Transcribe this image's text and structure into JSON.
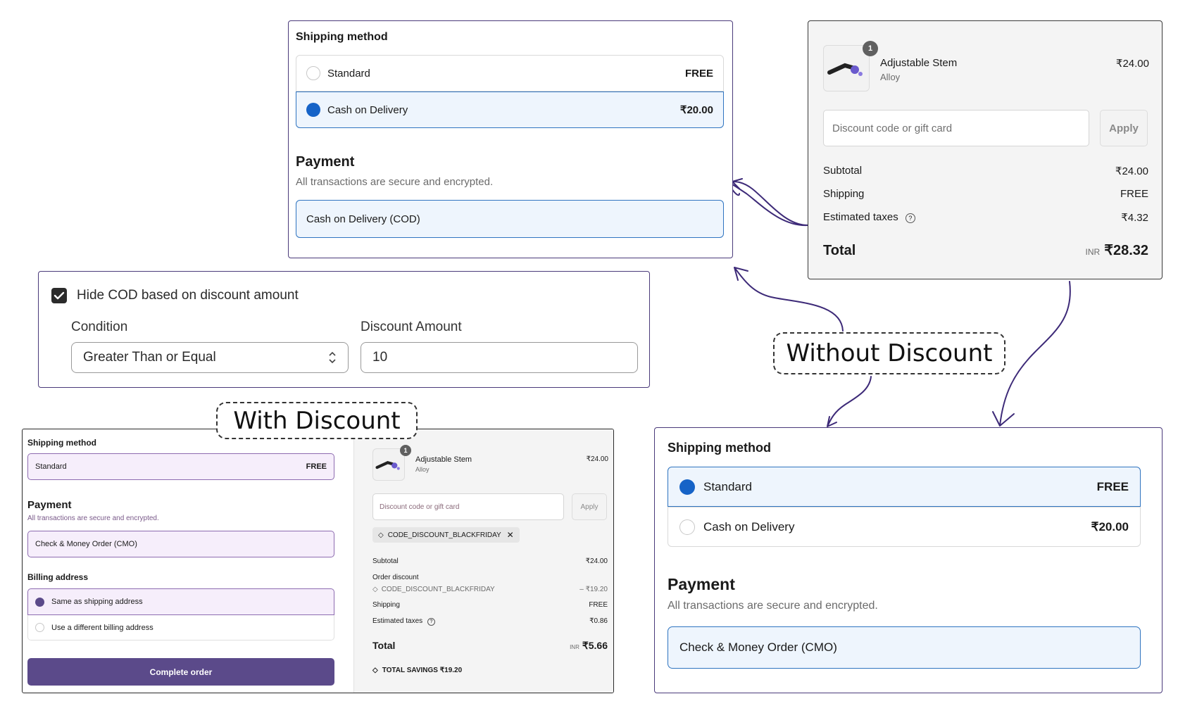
{
  "colors": {
    "accent": "#1663c7",
    "selected_bg": "#eef5fd",
    "frame": "#4a3a7a",
    "purple_btn": "#5b4a8a",
    "purple_field": "#f6eefb"
  },
  "labels": {
    "with_discount": "With Discount",
    "without_discount": "Without Discount"
  },
  "top_checkout": {
    "shipping_title": "Shipping method",
    "options": [
      {
        "label": "Standard",
        "price": "FREE",
        "selected": false
      },
      {
        "label": "Cash on Delivery",
        "price": "₹20.00",
        "selected": true
      }
    ],
    "payment_title": "Payment",
    "payment_subtitle": "All transactions are secure and encrypted.",
    "payment_method": "Cash on Delivery (COD)"
  },
  "top_summary": {
    "item": {
      "name": "Adjustable Stem",
      "variant": "Alloy",
      "price": "₹24.00",
      "qty": "1"
    },
    "discount_placeholder": "Discount code or gift card",
    "apply": "Apply",
    "rows": [
      {
        "label": "Subtotal",
        "value": "₹24.00"
      },
      {
        "label": "Shipping",
        "value": "FREE"
      },
      {
        "label": "Estimated taxes",
        "value": "₹4.32"
      }
    ],
    "total_label": "Total",
    "currency": "INR",
    "total_value": "₹28.32"
  },
  "settings": {
    "checkbox_label": "Hide COD based on discount amount",
    "checked": true,
    "condition_label": "Condition",
    "condition_value": "Greater Than or Equal",
    "amount_label": "Discount Amount",
    "amount_value": "10"
  },
  "with_discount": {
    "shipping_title": "Shipping method",
    "shipping_option": {
      "label": "Standard",
      "price": "FREE"
    },
    "payment_title": "Payment",
    "payment_subtitle": "All transactions are secure and encrypted.",
    "payment_method": "Check & Money Order (CMO)",
    "billing_title": "Billing address",
    "billing_options": [
      {
        "label": "Same as shipping address",
        "selected": true
      },
      {
        "label": "Use a different billing address",
        "selected": false
      }
    ],
    "complete_button": "Complete order",
    "summary": {
      "item": {
        "name": "Adjustable Stem",
        "variant": "Alloy",
        "price": "₹24.00",
        "qty": "1"
      },
      "discount_placeholder": "Discount code or gift card",
      "apply": "Apply",
      "code_tag": "CODE_DISCOUNT_BLACKFRIDAY",
      "subtotal_label": "Subtotal",
      "subtotal_value": "₹24.00",
      "order_discount_label": "Order discount",
      "order_discount_code": "CODE_DISCOUNT_BLACKFRIDAY",
      "order_discount_value": "– ₹19.20",
      "shipping_label": "Shipping",
      "shipping_value": "FREE",
      "taxes_label": "Estimated taxes",
      "taxes_value": "₹0.86",
      "total_label": "Total",
      "currency": "INR",
      "total_value": "₹5.66",
      "savings_label": "TOTAL SAVINGS",
      "savings_value": "₹19.20"
    }
  },
  "without_discount": {
    "shipping_title": "Shipping method",
    "options": [
      {
        "label": "Standard",
        "price": "FREE",
        "selected": true
      },
      {
        "label": "Cash on Delivery",
        "price": "₹20.00",
        "selected": false
      }
    ],
    "payment_title": "Payment",
    "payment_subtitle": "All transactions are secure and encrypted.",
    "payment_method": "Check & Money Order (CMO)"
  }
}
